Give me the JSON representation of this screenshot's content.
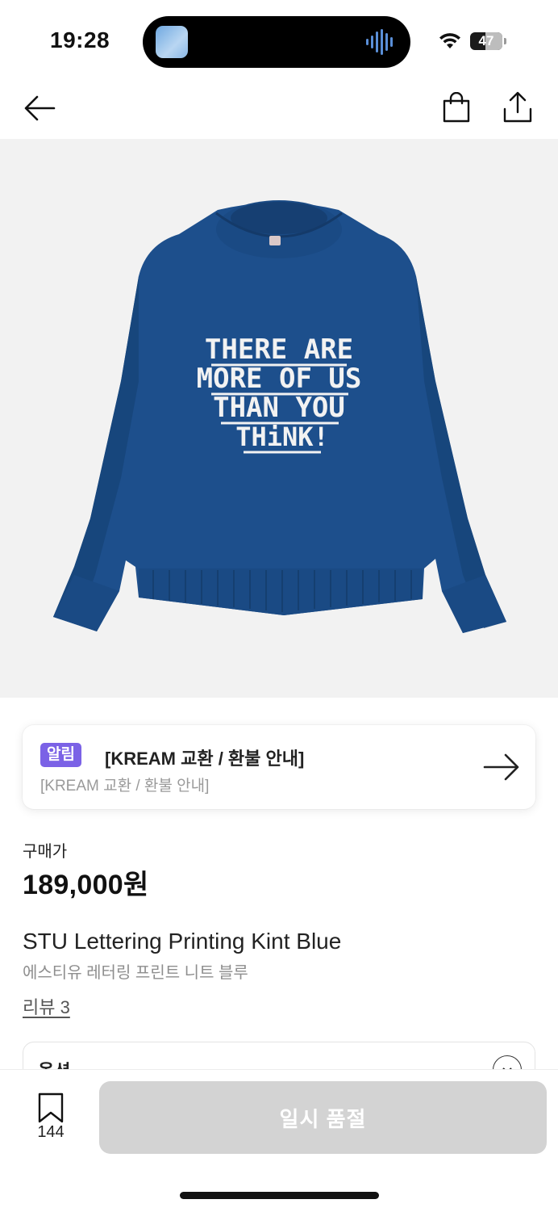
{
  "status_bar": {
    "time": "19:28",
    "battery_level": "47"
  },
  "nav": {
    "back_icon": "arrow-left-icon",
    "bag_icon": "shopping-bag-icon",
    "share_icon": "share-icon"
  },
  "product_image": {
    "print_lines": [
      "THERE ARE",
      "MORE OF US",
      "THAN YOU",
      "THiNK!"
    ],
    "sweater_color": "#1d4f8c",
    "background_color": "#f2f2f2"
  },
  "notice": {
    "badge": "알림",
    "title": "[KREAM 교환 / 환불 안내]",
    "subtitle": "[KREAM 교환 / 환불 안내]",
    "badge_color": "#7b62e6"
  },
  "price": {
    "label": "구매가",
    "value": "189,000원"
  },
  "product": {
    "name_en": "STU Lettering Printing Kint Blue",
    "name_ko": "에스티유 레터링 프린트 니트 블루",
    "reviews": "리뷰 3"
  },
  "option": {
    "label": "옵션"
  },
  "bottom_bar": {
    "bookmark_count": "144",
    "soldout_label": "일시 품절",
    "button_color": "#d3d3d3"
  }
}
